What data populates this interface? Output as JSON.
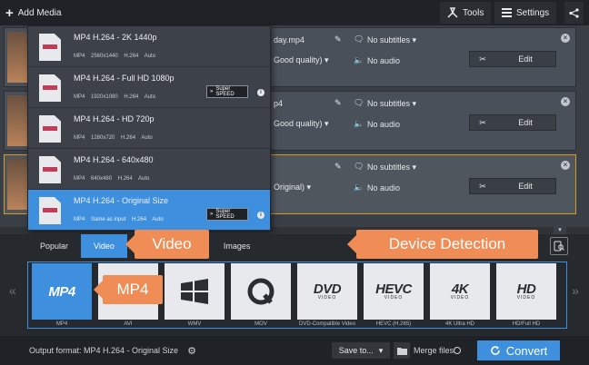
{
  "topbar": {
    "add_media": "Add Media",
    "tools": "Tools",
    "settings": "Settings"
  },
  "files": [
    {
      "filename_partial": "day.mp4",
      "quality": "Good quality)",
      "subtitles": "No subtitles",
      "audio": "No audio",
      "edit": "Edit"
    },
    {
      "filename_partial": "p4",
      "quality": "Good quality)",
      "subtitles": "No subtitles",
      "audio": "No audio",
      "edit": "Edit"
    },
    {
      "filename_partial": "",
      "quality": "Original)",
      "subtitles": "No subtitles",
      "audio": "No audio",
      "edit": "Edit"
    }
  ],
  "presets": [
    {
      "name": "MP4 H.264 - 2K 1440p",
      "specs": "MP4    2560x1440    H.264    Auto",
      "selected": false,
      "superspeed": false
    },
    {
      "name": "MP4 H.264 - Full HD 1080p",
      "specs": "MP4    1920x1080    H.264    Auto",
      "selected": false,
      "superspeed": true
    },
    {
      "name": "MP4 H.264 - HD 720p",
      "specs": "MP4    1280x720    H.264    Auto",
      "selected": false,
      "superspeed": false
    },
    {
      "name": "MP4 H.264 - 640x480",
      "specs": "MP4    640x480    H.264    Auto",
      "selected": false,
      "superspeed": false
    },
    {
      "name": "MP4 H.264 - Original Size",
      "specs": "MP4    Same as input    H.264    Auto",
      "selected": true,
      "superspeed": true
    }
  ],
  "superspeed": {
    "line1": "Super",
    "line2": "SPEED"
  },
  "tabs": {
    "popular": "Popular",
    "video": "Video",
    "images": "Images"
  },
  "callouts": {
    "video": "Video",
    "device_detection": "Device Detection",
    "mp4": "MP4"
  },
  "formats": [
    {
      "tile": "MP4",
      "label": "MP4",
      "selected": true
    },
    {
      "tile": "AVI",
      "label": "AVI",
      "selected": false
    },
    {
      "tile": "WMV",
      "label": "WMV",
      "selected": false
    },
    {
      "tile": "MOV",
      "label": "MOV",
      "selected": false
    },
    {
      "tile": "DVD",
      "tile_sub": "VIDEO",
      "label": "DVD-Compatible Video",
      "selected": false
    },
    {
      "tile": "HEVC",
      "tile_sub": "VIDEO",
      "label": "HEVC (H.265)",
      "selected": false
    },
    {
      "tile": "4K",
      "tile_sub": "VIDEO",
      "label": "4K Ultra HD",
      "selected": false
    },
    {
      "tile": "HD",
      "tile_sub": "VIDEO",
      "label": "HD/Full HD",
      "selected": false
    }
  ],
  "bottombar": {
    "output_format": "Output format: MP4 H.264 - Original Size",
    "save_to": "Save to...",
    "merge_files": "Merge files:",
    "convert": "Convert"
  },
  "colors": {
    "accent": "#3e8fde",
    "callout": "#f08d57",
    "selected_border": "#d49a2a"
  }
}
